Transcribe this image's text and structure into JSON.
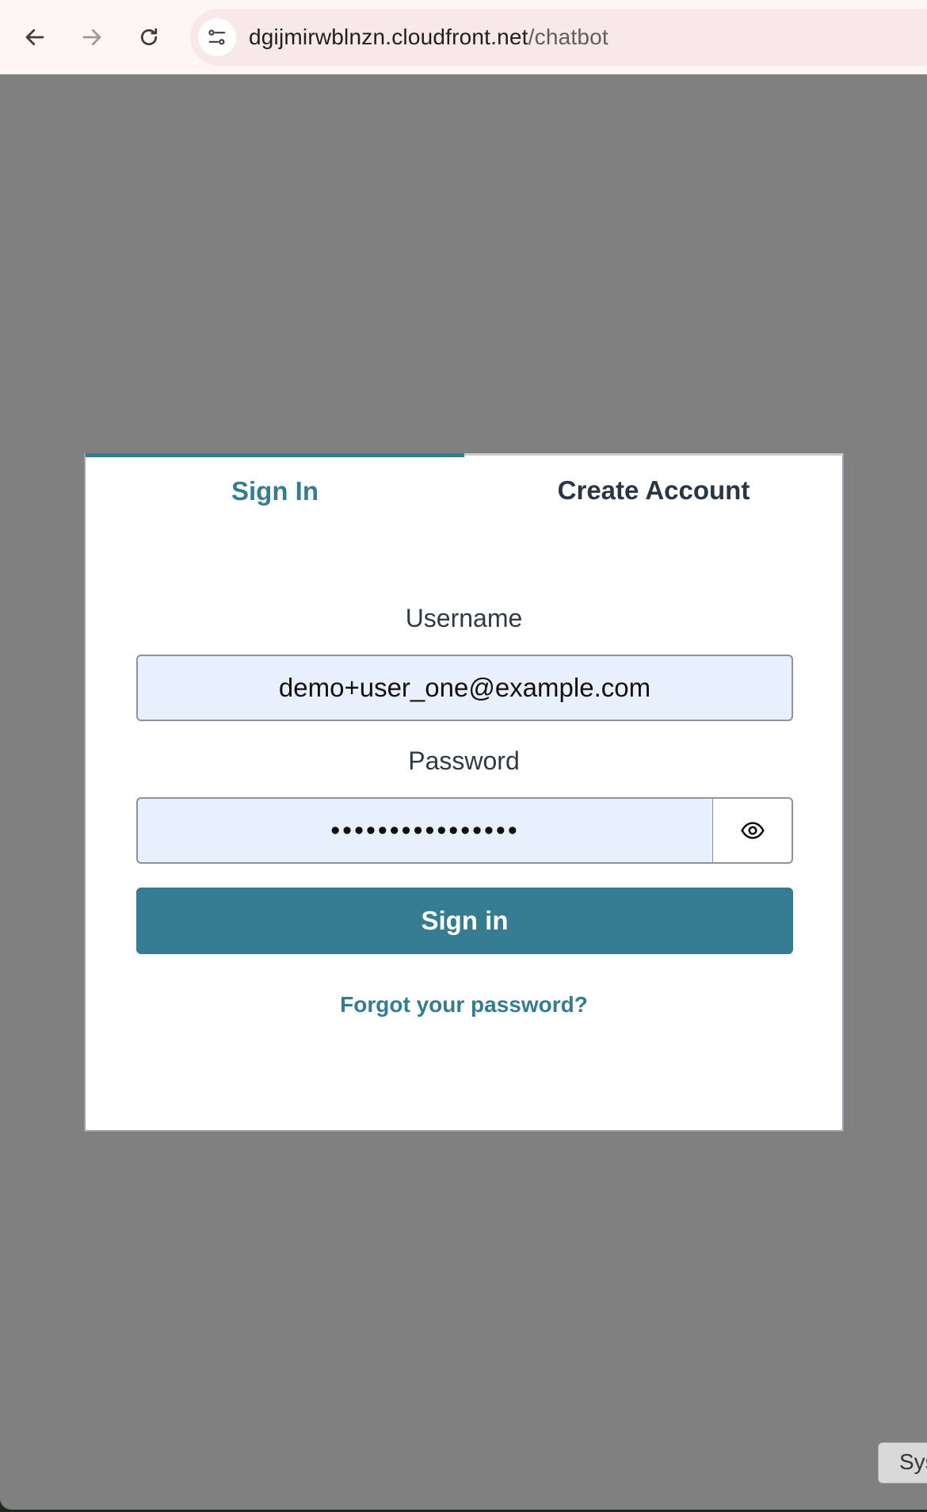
{
  "browser": {
    "url_host": "dgijmirwblnzn.cloudfront.net",
    "url_path": "/chatbot"
  },
  "auth": {
    "tabs": [
      {
        "label": "Sign In",
        "active": true
      },
      {
        "label": "Create Account",
        "active": false
      }
    ],
    "username_label": "Username",
    "username_value": "demo+user_one@example.com",
    "password_label": "Password",
    "password_value": "••••••••••••••••",
    "submit_label": "Sign in",
    "forgot_label": "Forgot your password?"
  },
  "corner_button_label": "Sys",
  "colors": {
    "accent": "#357c91",
    "backdrop": "#808080",
    "input_bg": "#e8effd"
  },
  "icons": [
    "back-arrow-icon",
    "forward-arrow-icon",
    "reload-icon",
    "site-settings-icon",
    "eye-icon"
  ]
}
